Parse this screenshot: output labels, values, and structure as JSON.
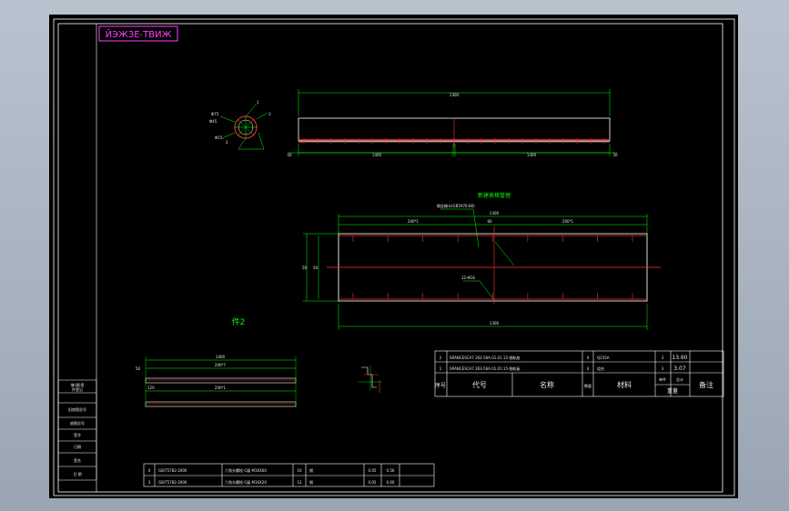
{
  "title_tag": "ЙЭЖЗЕ-ТВИЖ",
  "section_view_title": "新建表格管理",
  "part_label": "件2",
  "top_view": {
    "overall_dim": "1300",
    "left_dim": "1400",
    "right_dim": "1400",
    "end_dim_left": "50",
    "end_dim_right": "50"
  },
  "section": {
    "top_dim": "1300",
    "left_sub": "200*1",
    "right_sub": "200*1",
    "mid_sub": "60",
    "height_outer": "50",
    "height_inner": "50",
    "bottom_dim": "1300",
    "leader_note": "钢丝绳卡(GB5976-86)",
    "leader_note2": "12-Φ18"
  },
  "small_parts": {
    "upper_dim": "1400",
    "upper_sub": "200*7",
    "upper_end": "50",
    "lower_sub": "200*1",
    "lower_end": "120"
  },
  "bom_upper": {
    "rows": [
      {
        "no": "2",
        "code": "SRANCESCA7 262-56A.01.01.15-钢轨座",
        "name": "",
        "qty": "4",
        "material": "Q235A",
        "unit": "3",
        "total": "13.60"
      },
      {
        "no": "1",
        "code": "SRANCESCA7 263-56A.01.01.15-钢轨板",
        "name": "",
        "qty": "4",
        "material": "组合",
        "unit": "3",
        "total": "3.07"
      }
    ],
    "headers": {
      "no": "序号",
      "code": "代号",
      "name": "名称",
      "qty": "数量",
      "material": "材料",
      "unit": "单件",
      "total": "总计",
      "weight": "重量",
      "remark": "备注"
    }
  },
  "bom_lower": {
    "rows": [
      {
        "no": "4",
        "code": "GB/T5782-2000",
        "name": "六角头螺栓-C级 M16X60",
        "qty": "10",
        "material": "钢",
        "unit": "0.05",
        "total": "0.56"
      },
      {
        "no": "3",
        "code": "GB/T5782-2000",
        "name": "六角头螺栓-C级 M16X20",
        "qty": "12",
        "material": "钢",
        "unit": "0.05",
        "total": "0.60"
      }
    ]
  },
  "left_column": {
    "items": [
      "借(通)用",
      "件登记",
      "旧底图总号",
      "底图总号",
      "签字",
      "日期",
      "签名",
      "日 期"
    ]
  },
  "circle_callouts": {
    "n1": "1",
    "n2": "2",
    "n3": "3",
    "label_a": "Φ75",
    "label_b": "Φ45",
    "label_c": "Φ15"
  }
}
